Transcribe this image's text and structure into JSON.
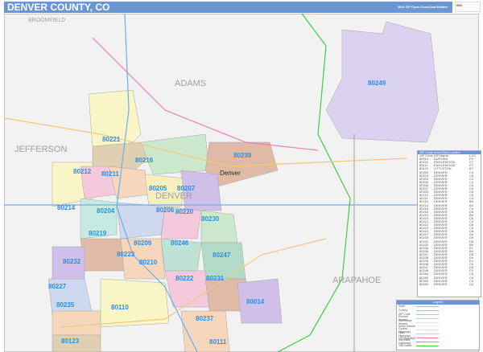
{
  "header": {
    "title": "DENVER COUNTY, CO",
    "edition": "2022 ZIP Code ColorCast Edition",
    "logo": "Market MAPS"
  },
  "map": {
    "counties": [
      "ADAMS",
      "JEFFERSON",
      "DENVER",
      "ARAPAHOE",
      "BROOMFIELD"
    ],
    "city": "Denver",
    "zips": [
      "80249",
      "80221",
      "80216",
      "80239",
      "80212",
      "80211",
      "80205",
      "80207",
      "80204",
      "80214",
      "80206",
      "80220",
      "80230",
      "80219",
      "80209",
      "80246",
      "80223",
      "80247",
      "80210",
      "80232",
      "80222",
      "80231",
      "80227",
      "80235",
      "80110",
      "80014",
      "80237",
      "80123",
      "80111"
    ]
  },
  "zip_table": {
    "title": "ZIP Code Index/Grid Locator",
    "columns": [
      "ZIP Code",
      "ZIP Name",
      "LOC"
    ],
    "rows": [
      [
        "80014",
        "AURORA",
        "F6"
      ],
      [
        "80110",
        "ENGLEWOOD",
        "C7"
      ],
      [
        "80111",
        "ENGLEWOOD",
        "E7"
      ],
      [
        "80123",
        "LITTLETON",
        "B7"
      ],
      [
        "80202",
        "DENVER",
        "C4"
      ],
      [
        "80203",
        "DENVER",
        "C5"
      ],
      [
        "80204",
        "DENVER",
        "C4"
      ],
      [
        "80205",
        "DENVER",
        "C4"
      ],
      [
        "80206",
        "DENVER",
        "C5"
      ],
      [
        "80207",
        "DENVER",
        "D4"
      ],
      [
        "80209",
        "DENVER",
        "C5"
      ],
      [
        "80210",
        "DENVER",
        "C6"
      ],
      [
        "80211",
        "DENVER",
        "C4"
      ],
      [
        "80212",
        "DENVER",
        "B4"
      ],
      [
        "80214",
        "DENVER",
        "B4"
      ],
      [
        "80216",
        "DENVER",
        "C4"
      ],
      [
        "80218",
        "DENVER",
        "D5"
      ],
      [
        "80219",
        "DENVER",
        "B5"
      ],
      [
        "80220",
        "DENVER",
        "D5"
      ],
      [
        "80221",
        "DENVER",
        "C3"
      ],
      [
        "80222",
        "DENVER",
        "D6"
      ],
      [
        "80223",
        "DENVER",
        "C5"
      ],
      [
        "80224",
        "DENVER",
        "D6"
      ],
      [
        "80227",
        "DENVER",
        "A6"
      ],
      [
        "80230",
        "DENVER",
        "D5"
      ],
      [
        "80231",
        "DENVER",
        "D6"
      ],
      [
        "80232",
        "DENVER",
        "B6"
      ],
      [
        "80235",
        "DENVER",
        "B7"
      ],
      [
        "80236",
        "DENVER",
        "B6"
      ],
      [
        "80237",
        "DENVER",
        "D6"
      ],
      [
        "80238",
        "DENVER",
        "D4"
      ],
      [
        "80239",
        "DENVER",
        "E4"
      ],
      [
        "80246",
        "DENVER",
        "C5"
      ],
      [
        "80247",
        "DENVER",
        "D5"
      ],
      [
        "80249",
        "DENVER",
        "F3"
      ],
      [
        "80264",
        "DENVER",
        "C5"
      ],
      [
        "80290",
        "DENVER",
        "C5"
      ],
      [
        "80293",
        "DENVER",
        "C4"
      ],
      [
        "80294",
        "DENVER",
        "C4"
      ]
    ]
  },
  "legend": {
    "title": "Legend",
    "items": [
      {
        "label": "State",
        "color": "#8fd18f"
      },
      {
        "label": "County",
        "color": "#bbbbbb"
      },
      {
        "label": "ZIP Code",
        "color": "#7fd0f0"
      },
      {
        "label": "Primary Streets",
        "color": "#cccccc"
      },
      {
        "label": "Secondary Streets",
        "color": "#dddddd"
      },
      {
        "label": "Minor Streets",
        "color": "#eeeeee"
      },
      {
        "label": "County Highways",
        "color": "#dddddd"
      },
      {
        "label": "State Highways",
        "color": "#f5c77a"
      },
      {
        "label": "US Highways",
        "color": "#f07ab5"
      },
      {
        "label": "Interstate Highways",
        "color": "#6aaef0"
      },
      {
        "label": "Toll Roads",
        "color": "#3ccf3c"
      }
    ]
  }
}
